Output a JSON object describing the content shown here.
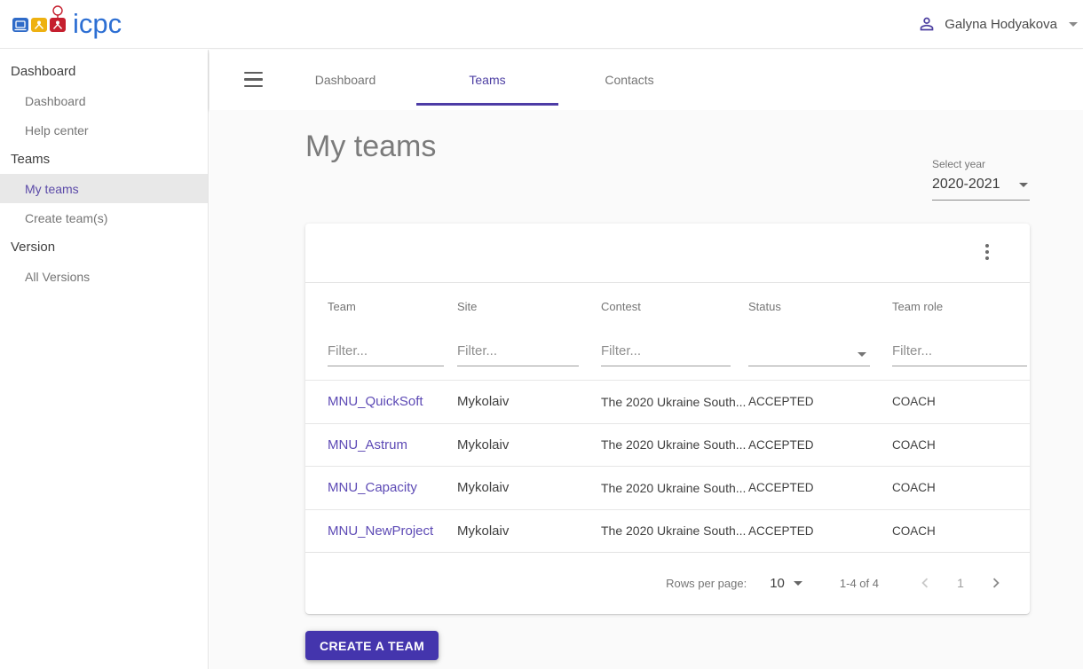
{
  "header": {
    "logo_text": "icpc",
    "user_name": "Galyna Hodyakova"
  },
  "sidebar": {
    "sections": [
      {
        "title": "Dashboard",
        "items": [
          {
            "label": "Dashboard"
          },
          {
            "label": "Help center"
          }
        ]
      },
      {
        "title": "Teams",
        "items": [
          {
            "label": "My teams",
            "active": true
          },
          {
            "label": "Create team(s)"
          }
        ]
      },
      {
        "title": "Version",
        "items": [
          {
            "label": "All Versions"
          }
        ]
      }
    ]
  },
  "nav": {
    "tabs": [
      {
        "label": "Dashboard"
      },
      {
        "label": "Teams",
        "active": true
      },
      {
        "label": "Contacts"
      }
    ]
  },
  "main": {
    "title": "My teams",
    "year_select": {
      "label": "Select year",
      "value": "2020-2021"
    },
    "table": {
      "columns": [
        "Team",
        "Site",
        "Contest",
        "Status",
        "Team role"
      ],
      "filter_placeholder": "Filter...",
      "rows": [
        {
          "team": "MNU_QuickSoft",
          "site": "Mykolaiv",
          "contest": "The 2020 Ukraine South...",
          "status": "ACCEPTED",
          "role": "COACH"
        },
        {
          "team": "MNU_Astrum",
          "site": "Mykolaiv",
          "contest": "The 2020 Ukraine South...",
          "status": "ACCEPTED",
          "role": "COACH"
        },
        {
          "team": "MNU_Capacity",
          "site": "Mykolaiv",
          "contest": "The 2020 Ukraine South...",
          "status": "ACCEPTED",
          "role": "COACH"
        },
        {
          "team": "MNU_NewProject",
          "site": "Mykolaiv",
          "contest": "The 2020 Ukraine South...",
          "status": "ACCEPTED",
          "role": "COACH"
        }
      ],
      "pagination": {
        "rows_per_page_label": "Rows per page:",
        "rows_per_page": "10",
        "range_label": "1-4 of 4",
        "page": "1"
      }
    },
    "create_button_label": "CREATE A TEAM"
  },
  "icons": {
    "menu-icon": "hamburger (3 bars)",
    "person-icon": "person-outline",
    "kebab-menu-icon": "vertical 3 dots",
    "dropdown-caret-icon": "filled down triangle",
    "chevron-left-icon": "previous page",
    "chevron-right-icon": "next page"
  },
  "colors": {
    "accent_purple": "#4d3fa3",
    "selected_item_purple": "#5b4aa8",
    "team_link_purple": "#5d4ab5",
    "button_indigo": "#4435ad",
    "logo_blue": "#2d6fd3",
    "logo_gold": "#eeb111",
    "logo_red": "#c51f2e",
    "content_background": "#fafafa"
  }
}
